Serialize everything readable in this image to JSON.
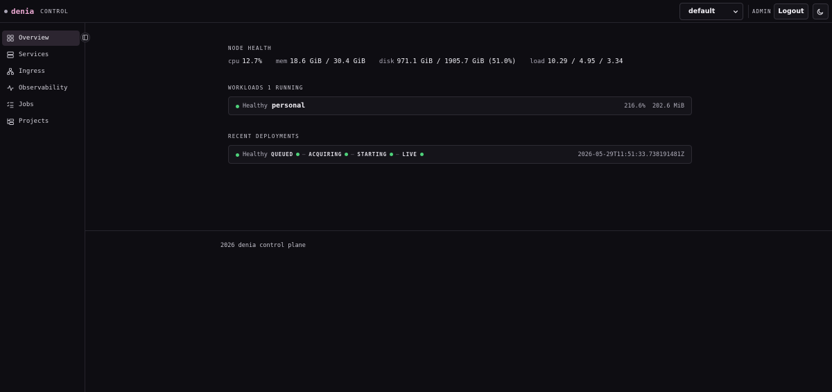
{
  "brand": {
    "name": "denia",
    "subtitle": "CONTROL"
  },
  "header": {
    "namespace_selected": "default",
    "role": "ADMIN",
    "logout_label": "Logout",
    "theme_icon": "moon-icon"
  },
  "sidebar": {
    "items": [
      {
        "label": "Overview",
        "icon": "grid-icon",
        "active": true
      },
      {
        "label": "Services",
        "icon": "server-icon"
      },
      {
        "label": "Ingress",
        "icon": "network-icon"
      },
      {
        "label": "Observability",
        "icon": "activity-icon"
      },
      {
        "label": "Jobs",
        "icon": "list-checks-icon"
      },
      {
        "label": "Projects",
        "icon": "folder-tree-icon"
      }
    ]
  },
  "node_health": {
    "title": "NODE HEALTH",
    "cpu": {
      "label": "cpu",
      "value": "12.7%"
    },
    "mem": {
      "label": "mem",
      "value": "18.6 GiB / 30.4 GiB"
    },
    "disk": {
      "label": "disk",
      "value": "971.1 GiB / 1905.7 GiB (51.0%)"
    },
    "load": {
      "label": "load",
      "value": "10.29 / 4.95 / 3.34"
    }
  },
  "workloads": {
    "title": "WORKLOADS 1 RUNNING",
    "items": [
      {
        "status": "Healthy",
        "name": "personal",
        "cpu": "216.6%",
        "memory": "202.6 MiB"
      }
    ]
  },
  "deployments": {
    "title": "RECENT DEPLOYMENTS",
    "items": [
      {
        "status": "Healthy",
        "stages": [
          "QUEUED",
          "ACQUIRING",
          "STARTING",
          "LIVE"
        ],
        "separator": "—",
        "timestamp": "2026-05-29T11:51:33.738191481Z"
      }
    ]
  },
  "footer": {
    "text": "2026 denia control plane"
  },
  "colors": {
    "accent_pink": "#e7a6cf",
    "status_green": "#4ed17a",
    "background": "#0e0d12"
  }
}
